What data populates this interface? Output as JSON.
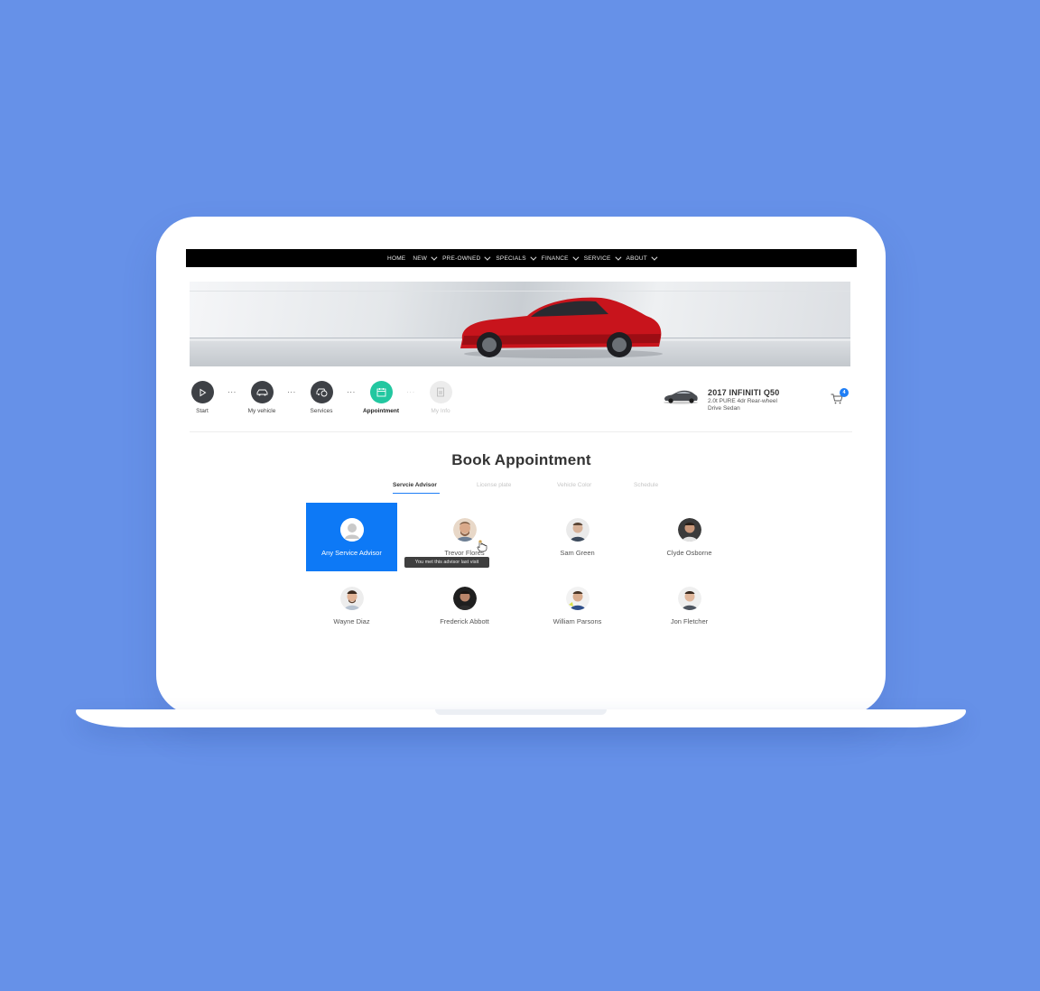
{
  "nav": {
    "items": [
      {
        "label": "HOME",
        "caret": false
      },
      {
        "label": "NEW",
        "caret": true
      },
      {
        "label": "PRE-OWNED",
        "caret": true
      },
      {
        "label": "SPECIALS",
        "caret": true
      },
      {
        "label": "FINANCE",
        "caret": true
      },
      {
        "label": "SERVICE",
        "caret": true
      },
      {
        "label": "ABOUT",
        "caret": true
      }
    ]
  },
  "steps": [
    {
      "label": "Start",
      "icon": "play-icon",
      "state": "done"
    },
    {
      "label": "My vehicle",
      "icon": "car-icon",
      "state": "done"
    },
    {
      "label": "Services",
      "icon": "service-icon",
      "state": "done"
    },
    {
      "label": "Appointment",
      "icon": "calendar-icon",
      "state": "active"
    },
    {
      "label": "My Info",
      "icon": "id-card-icon",
      "state": "disabled"
    }
  ],
  "vehicle": {
    "title": "2017 INFINITI Q50",
    "subtitle": "2.0t PURE 4dr Rear-wheel Drive Sedan"
  },
  "cart": {
    "count": "4"
  },
  "booking": {
    "title": "Book Appointment",
    "tabs": [
      "Servcie Advisor",
      "License plate",
      "Vehicle Color",
      "Schedule"
    ],
    "active_tab": "Servcie Advisor",
    "advisors": [
      {
        "name": "Any Service Advisor",
        "selected": true
      },
      {
        "name": "Trevor Flores",
        "selected": false
      },
      {
        "name": "Sam Green",
        "selected": false
      },
      {
        "name": "Clyde Osborne",
        "selected": false
      },
      {
        "name": "Wayne Diaz",
        "selected": false
      },
      {
        "name": "Frederick Abbott",
        "selected": false
      },
      {
        "name": "William Parsons",
        "selected": false
      },
      {
        "name": "Jon Fletcher",
        "selected": false
      }
    ],
    "tooltip": "You met this advisor last visit"
  },
  "colors": {
    "background": "#6691e8",
    "accent_blue": "#0d79f6",
    "step_active": "#22c7a0",
    "nav_bg": "#000000",
    "car_red": "#c8141c"
  }
}
